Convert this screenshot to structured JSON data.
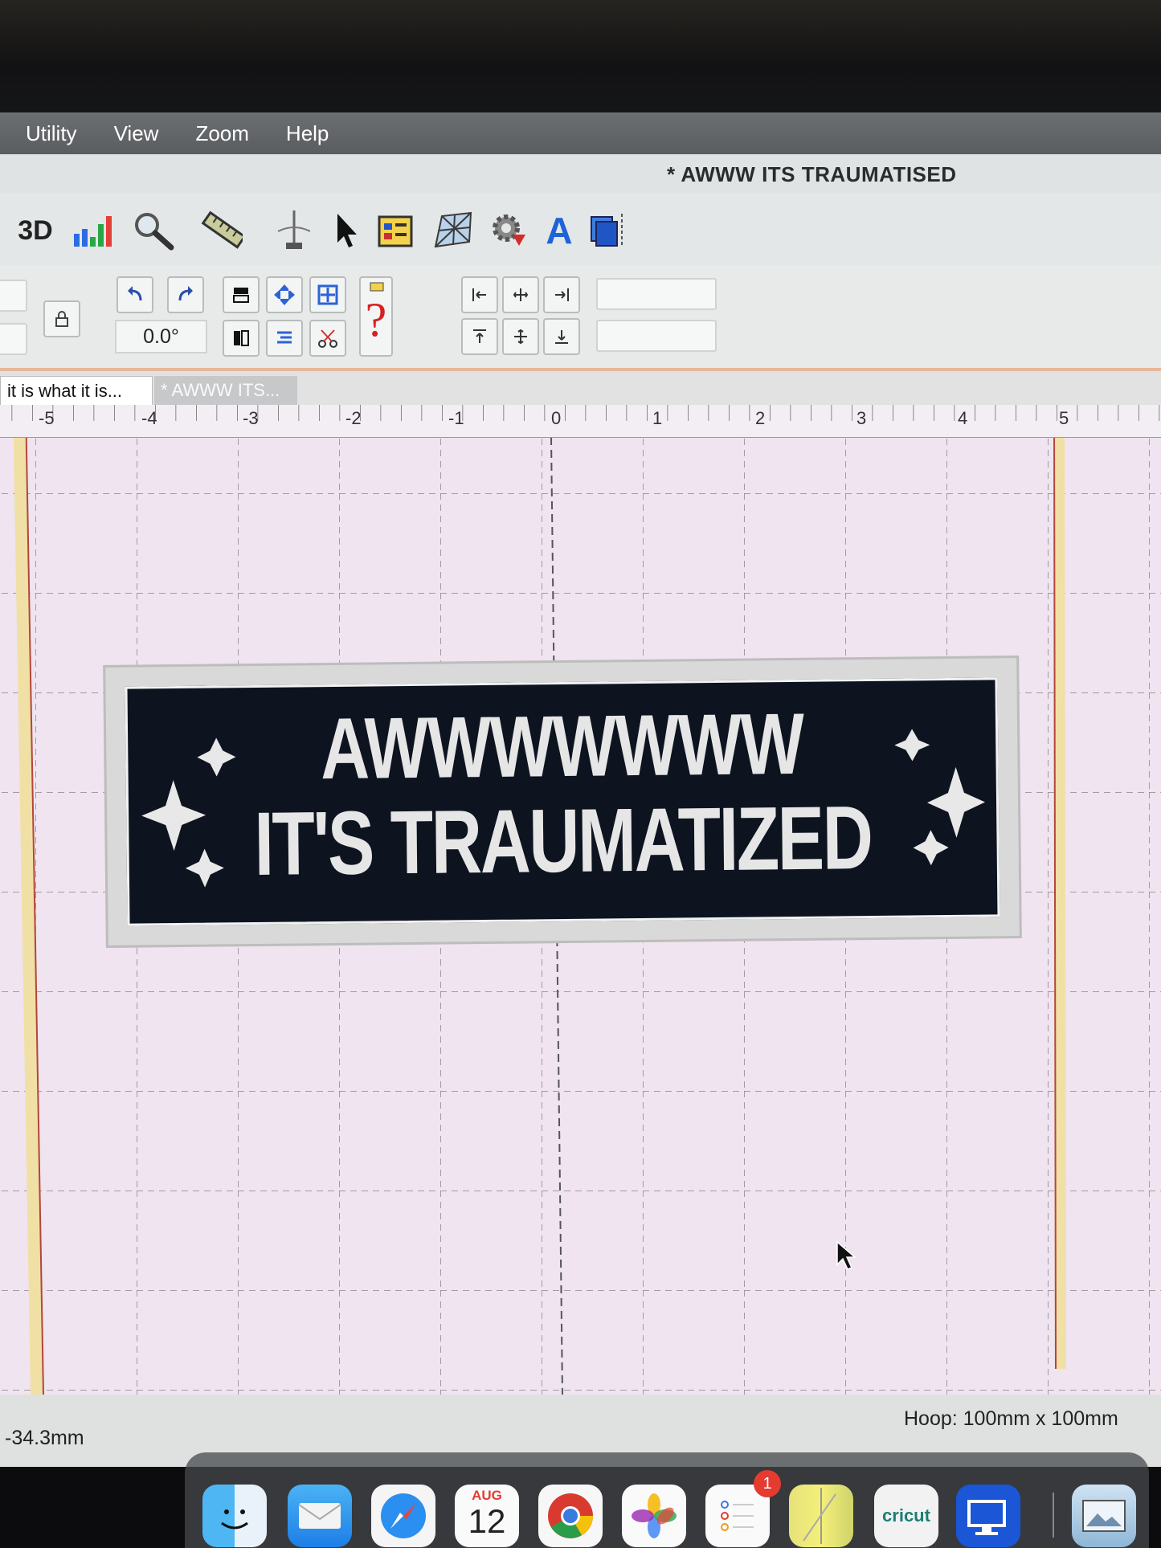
{
  "menu": {
    "items": [
      "Utility",
      "View",
      "Zoom",
      "Help"
    ]
  },
  "document": {
    "title": "* AWWW ITS TRAUMATISED"
  },
  "toolbar": {
    "rotation_value": "0.0°"
  },
  "tabs": [
    {
      "label": "it is what it is..."
    },
    {
      "label": "* AWWW ITS..."
    }
  ],
  "ruler": {
    "labels": [
      "-5",
      "-4",
      "-3",
      "-2",
      "-1",
      "0",
      "1",
      "2",
      "3",
      "4",
      "5"
    ]
  },
  "design": {
    "line1": "AWWWWWWW",
    "line2": "IT'S TRAUMATIZED",
    "fill_color": "#0d1420",
    "thread_color": "#e6e6e6"
  },
  "status": {
    "coordinate": "-34.3mm",
    "hoop": "Hoop: 100mm x 100mm"
  },
  "dock": {
    "calendar_month": "AUG",
    "calendar_day": "12",
    "reminders_badge": "1",
    "cricut_label": "cricut"
  },
  "icons": [
    "3d-icon",
    "chart-icon",
    "magnifier-icon",
    "ruler-icon",
    "needle-icon",
    "pointer-icon",
    "color-table-icon",
    "net-icon",
    "gear-icon",
    "letter-a-icon",
    "copy-icon",
    "lock-icon",
    "undo-icon",
    "redo-icon"
  ]
}
